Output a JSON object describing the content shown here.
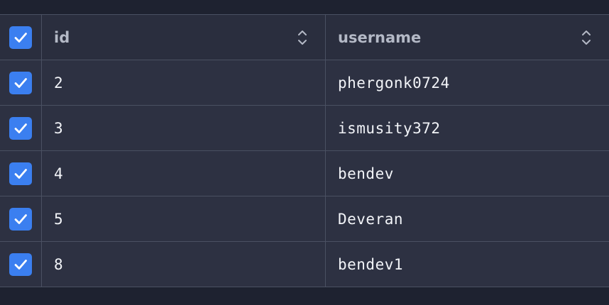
{
  "table": {
    "columns": {
      "id": "id",
      "username": "username"
    },
    "header_checked": true,
    "rows": [
      {
        "id": "2",
        "username": "phergonk0724",
        "checked": true
      },
      {
        "id": "3",
        "username": "ismusity372",
        "checked": true
      },
      {
        "id": "4",
        "username": "bendev",
        "checked": true
      },
      {
        "id": "5",
        "username": "Deveran",
        "checked": true
      },
      {
        "id": "8",
        "username": "bendev1",
        "checked": true
      }
    ]
  },
  "colors": {
    "background": "#1e2230",
    "row": "#2d3142",
    "header": "#2a2e3e",
    "border": "#4a5062",
    "checkbox": "#3b7ff0",
    "header_text": "#b4b9c6",
    "cell_text": "#f2f4f8"
  },
  "icons": {
    "checkbox": "check-icon",
    "sort": "sort-updown-icon"
  }
}
